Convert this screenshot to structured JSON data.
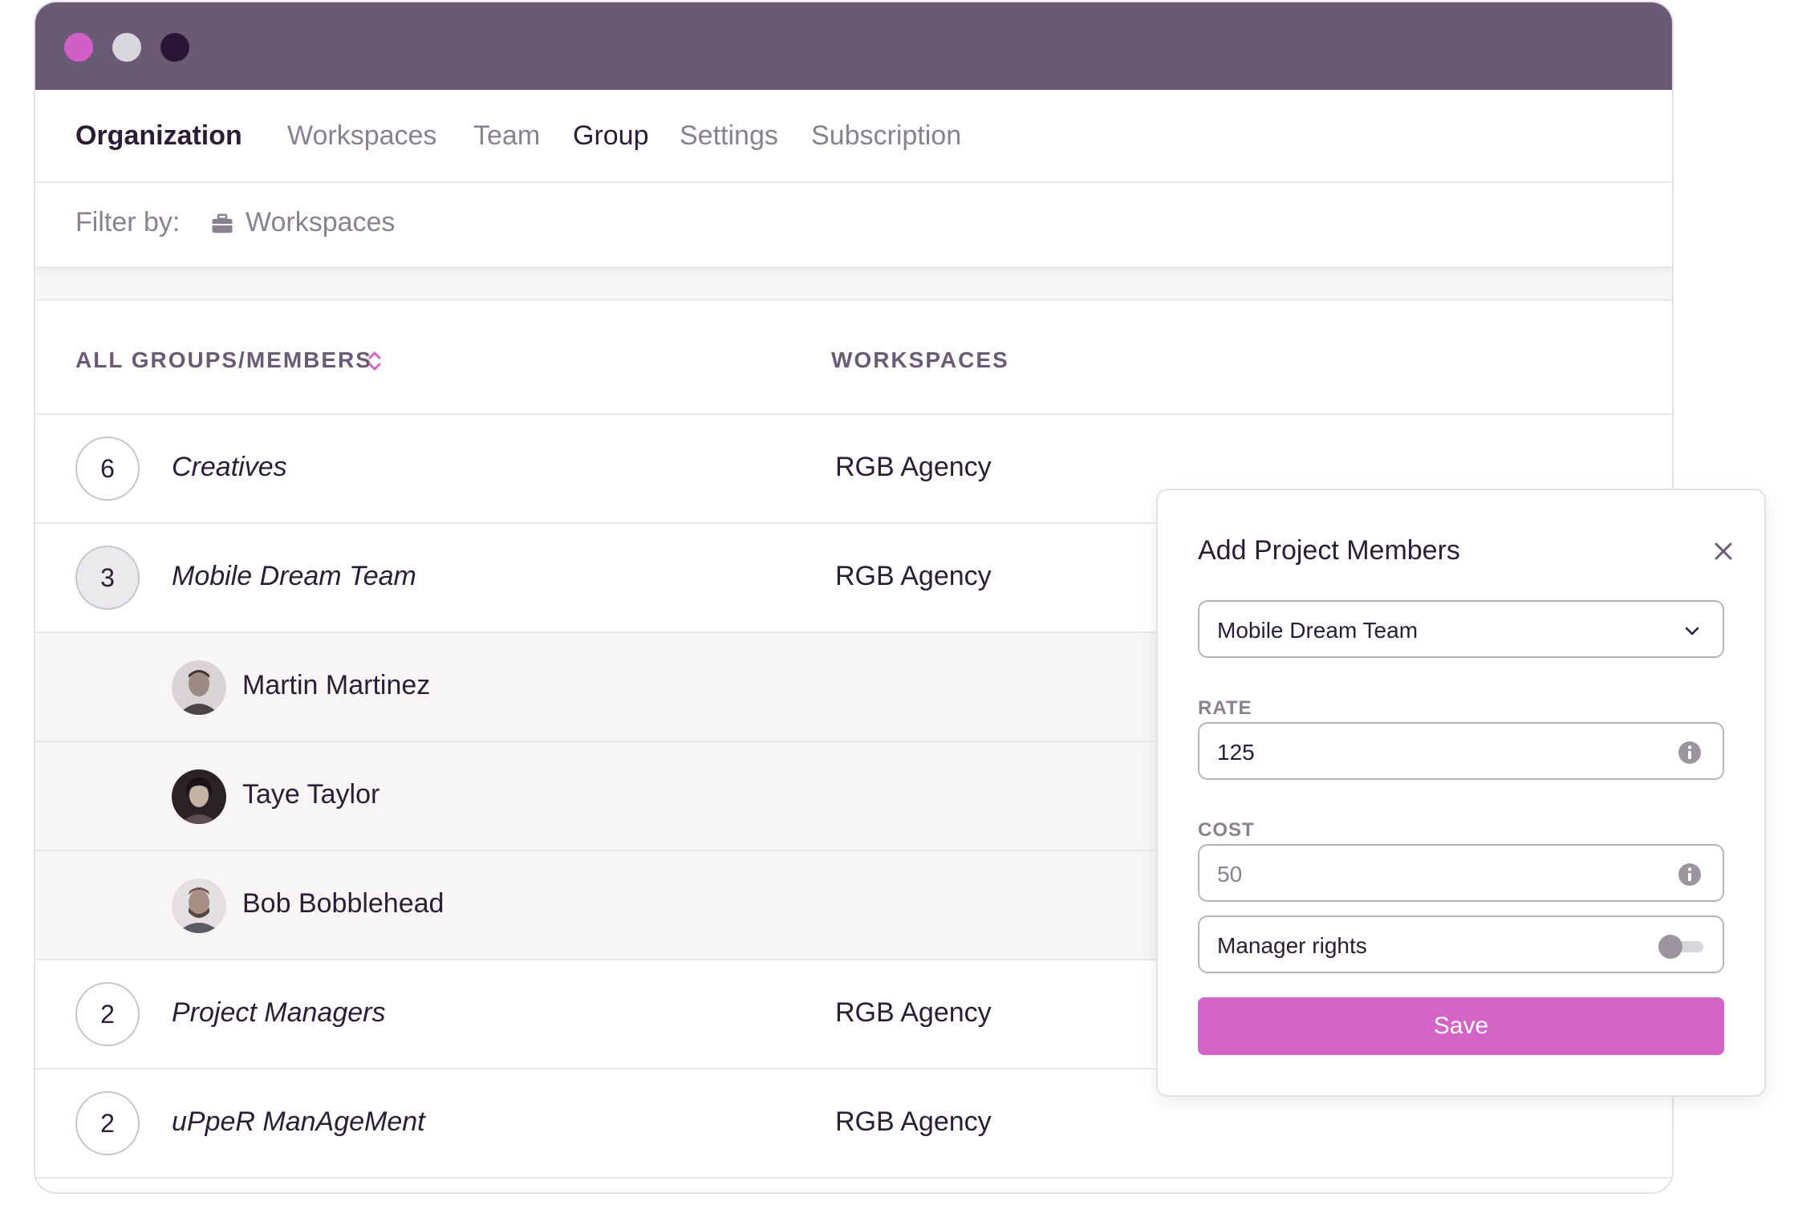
{
  "window": {
    "controls": [
      "close",
      "minimize",
      "maximize"
    ]
  },
  "nav": {
    "items": [
      {
        "label": "Organization"
      },
      {
        "label": "Workspaces"
      },
      {
        "label": "Team"
      },
      {
        "label": "Group"
      },
      {
        "label": "Settings"
      },
      {
        "label": "Subscription"
      }
    ],
    "active": "Organization"
  },
  "filter": {
    "label": "Filter by:",
    "value": "Workspaces",
    "icon": "briefcase-icon"
  },
  "table": {
    "columns": [
      "ALL GROUPS/MEMBERS",
      "WORKSPACES"
    ],
    "rows": [
      {
        "type": "group",
        "count": "6",
        "name": "Creatives",
        "workspace": "RGB Agency"
      },
      {
        "type": "group",
        "count": "3",
        "name": "Mobile Dream Team",
        "workspace": "RGB Agency",
        "expanded": true
      },
      {
        "type": "member",
        "name": "Martin Martinez"
      },
      {
        "type": "member",
        "name": "Taye Taylor"
      },
      {
        "type": "member",
        "name": "Bob Bobblehead"
      },
      {
        "type": "group",
        "count": "2",
        "name": "Project Managers",
        "workspace": "RGB Agency"
      },
      {
        "type": "group",
        "count": "2",
        "name": "uPpeR ManAgeMent",
        "workspace": "RGB Agency"
      }
    ]
  },
  "modal": {
    "title": "Add Project Members",
    "group_select": "Mobile Dream Team",
    "rate_label": "RATE",
    "rate_value": "125",
    "cost_label": "COST",
    "cost_placeholder": "50",
    "manager_label": "Manager rights",
    "manager_enabled": false,
    "save_label": "Save"
  },
  "colors": {
    "titlebar": "#6b5a76",
    "accent": "#d363c6",
    "text": "#2b1d35",
    "muted": "#8a8190"
  }
}
